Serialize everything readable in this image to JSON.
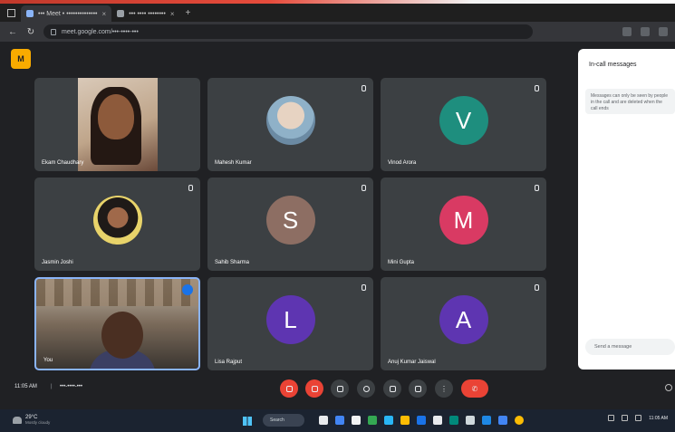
{
  "browser": {
    "tabs": [
      {
        "label": "••• Meet • ••••••••••••••"
      },
      {
        "label": "••• •••• ••••••••"
      }
    ],
    "url": "meet.google.com/•••-••••-•••"
  },
  "meet_logo": "M",
  "participants": [
    {
      "name": "Ekam Chaudhary",
      "avatar_type": "camera",
      "muted": false
    },
    {
      "name": "Mahesh Kumar",
      "avatar_type": "photo",
      "muted": true
    },
    {
      "name": "Vinod Arora",
      "avatar_type": "letter",
      "letter": "V",
      "color": "#1e8e7e",
      "muted": true
    },
    {
      "name": "Jasmin Joshi",
      "avatar_type": "photo",
      "muted": true
    },
    {
      "name": "Sahib Sharma",
      "avatar_type": "letter",
      "letter": "S",
      "color": "#8d6e63",
      "muted": true
    },
    {
      "name": "Mini Gupta",
      "avatar_type": "letter",
      "letter": "M",
      "color": "#d93a63",
      "muted": true
    },
    {
      "name": "You",
      "avatar_type": "selfview",
      "muted": false
    },
    {
      "name": "Lisa Rajput",
      "avatar_type": "letter",
      "letter": "L",
      "color": "#5e35b1",
      "muted": true
    },
    {
      "name": "Anuj Kumar Jaiswal",
      "avatar_type": "letter",
      "letter": "A",
      "color": "#5e35b1",
      "muted": true
    }
  ],
  "chat_panel": {
    "title": "In-call messages",
    "note": "Messages can only be seen by people in the call and are deleted when the call ends",
    "input_placeholder": "Send a message"
  },
  "meeting": {
    "time": "11:05 AM",
    "separator": "|",
    "code": "•••-••••-•••"
  },
  "taskbar": {
    "weather_temp": "29°C",
    "weather_desc": "Mostly cloudy",
    "search_label": "Search",
    "clock": "11:05 AM"
  },
  "colors": {
    "background": "#202124",
    "tile": "#3c4043",
    "end_call": "#ea4335",
    "logo": "#f9ab00"
  }
}
